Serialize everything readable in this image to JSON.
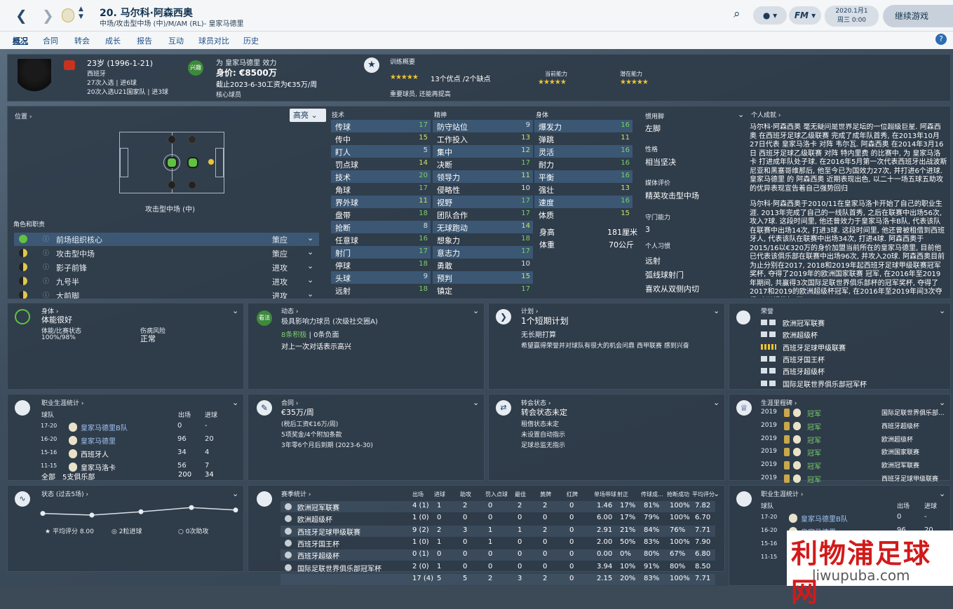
{
  "header": {
    "number_name": "20. 马尔科·阿森西奥",
    "position_club": "中场/攻击型中场 (中)/M/AM (RL)- 皇家马德里",
    "date": "2020.1月1",
    "weekday_time": "周三 0:00",
    "continue": "继续游戏",
    "fm": "FM"
  },
  "menu": [
    "概况",
    "合同",
    "转会",
    "成长",
    "报告",
    "互动",
    "球员对比",
    "历史"
  ],
  "profile": {
    "age": "23岁 (1996-1-21)",
    "nation": "西班牙",
    "caps": "27次入选 | 进6球",
    "u21": "20次入选U21国家队 | 进3球",
    "plays_for": "为 皇家马德里 效力",
    "value": "身价: €8500万",
    "contract": "截止2023-6-30工资为€35万/周",
    "squad_status": "核心球员",
    "badge": "兴趣"
  },
  "training": {
    "title": "训练概要",
    "summary": "13个优点 /2个缺点",
    "note": "重要球员, 还能再提高",
    "current_label": "当前能力",
    "potential_label": "潜在能力"
  },
  "position": {
    "title": "位置",
    "dropdown": "高亮",
    "pos_name": "攻击型中场 (中)"
  },
  "roles": {
    "title": "角色和职责",
    "items": [
      {
        "name": "前场组织核心",
        "duty": "策应"
      },
      {
        "name": "攻击型中场",
        "duty": "策应"
      },
      {
        "name": "影子前锋",
        "duty": "进攻"
      },
      {
        "name": "九号半",
        "duty": "进攻"
      },
      {
        "name": "大前脚",
        "duty": "进攻"
      }
    ]
  },
  "technical": {
    "title": "技术",
    "items": [
      [
        "传球",
        "17"
      ],
      [
        "传中",
        "15"
      ],
      [
        "盯人",
        "5"
      ],
      [
        "罚点球",
        "14"
      ],
      [
        "技术",
        "20"
      ],
      [
        "角球",
        "17"
      ],
      [
        "界外球",
        "11"
      ],
      [
        "盘带",
        "18"
      ],
      [
        "抢断",
        "8"
      ],
      [
        "任意球",
        "16"
      ],
      [
        "射门",
        "17"
      ],
      [
        "停球",
        "18"
      ],
      [
        "头球",
        "9"
      ],
      [
        "远射",
        "18"
      ]
    ]
  },
  "mental": {
    "title": "精神",
    "items": [
      [
        "防守站位",
        "9"
      ],
      [
        "工作投入",
        "13"
      ],
      [
        "集中",
        "12"
      ],
      [
        "决断",
        "17"
      ],
      [
        "领导力",
        "11"
      ],
      [
        "侵略性",
        "10"
      ],
      [
        "视野",
        "17"
      ],
      [
        "团队合作",
        "17"
      ],
      [
        "无球跑动",
        "14"
      ],
      [
        "想象力",
        "18"
      ],
      [
        "意志力",
        "17"
      ],
      [
        "勇敢",
        "10"
      ],
      [
        "预判",
        "15"
      ],
      [
        "镇定",
        "17"
      ]
    ]
  },
  "physical": {
    "title": "身体",
    "items": [
      [
        "爆发力",
        "16"
      ],
      [
        "弹跳",
        "11"
      ],
      [
        "灵活",
        "16"
      ],
      [
        "耐力",
        "16"
      ],
      [
        "平衡",
        "16"
      ],
      [
        "强壮",
        "13"
      ],
      [
        "速度",
        "16"
      ],
      [
        "体质",
        "15"
      ]
    ],
    "height_label": "身高",
    "height": "181厘米",
    "weight_label": "体重",
    "weight": "70公斤"
  },
  "info": {
    "foot_label": "惯用脚",
    "foot": "左脚",
    "personality_label": "性格",
    "personality": "相当坚决",
    "media_label": "媒体评价",
    "media": "精英攻击型中场",
    "gk_label": "守门能力",
    "gk": "3",
    "habits_label": "个人习惯",
    "habits": [
      "远射",
      "弧线球射门",
      "喜欢从双侧内切"
    ]
  },
  "achievements": {
    "title": "个人成就",
    "text1": "马尔科·阿森西奥 毫无疑问是世界足坛的一位超级巨星. 阿森西奥 在西班牙足球乙级联赛 完成了成年队首秀, 在2013年10月27日代表 皇家马洛卡 对阵 韦尔瓦. 阿森西奥 在2014年3月16日 西班牙足球乙级联赛 对阵 特内里费 的比赛中, 为 皇家马洛卡 打进成年队处子球. 在2016年5月第一次代表西班牙出战波斯尼亚和黑塞哥维那后, 他至今已为国效力27次, 并打进6个进球. 皇家马德里 的 阿森西奥 近期表现出色, 以二十一场五球五助攻的优异表现宣告着自己强势回归",
    "text2": "马尔科·阿森西奥于2010/11在皇家马洛卡开始了自己的职业生涯. 2013年完成了自己的一线队首秀, 之后在联赛中出场56次, 攻入7球. 这段时间里, 他还曾效力于皇家马洛卡B队, 代表该队在联赛中出场14次, 打进3球. 这段时间里, 他还曾被租借到西班牙人, 代表该队在联赛中出场34次, 打进4球. 阿森西奥于2015/16以€320万的身价加盟当前所在的皇家马德里, 目前他已代表该俱乐部在联赛中出场96次, 并攻入20球. 阿森西奥目前为止分别在2017, 2018和2019年起西班牙足球甲级联赛冠军奖杯, 夺得了2019年的欧洲国家联赛 冠军, 在2016年至2019年期间, 共赢得3次国际足联世界俱乐部杯的冠军奖杯, 夺得了2017和2019的欧洲超级杯冠军, 在2016年至2019年间3次夺得 欧洲超级杯 冠"
  },
  "body": {
    "title": "身体",
    "status": "体能很好",
    "cond_label": "体能/比赛状态",
    "cond": "100%/98%",
    "risk_label": "伤病风险",
    "risk": "正常"
  },
  "dynamics": {
    "title": "动态",
    "influence": "极具影响力球员 (次级社交圈A)",
    "pos": "8条积极",
    "neg": "0条负面",
    "note": "对上一次对话表示高兴",
    "badge": "看法"
  },
  "plan": {
    "title": "计划",
    "plan": "1个短期计划",
    "longterm": "无长期打算",
    "wish": "希望赢得荣誉并对球队有很大的机会问鼎 西甲联赛 感到兴奋"
  },
  "honours": {
    "title": "荣誉",
    "items": [
      "欧洲冠军联赛",
      "欧洲超级杯",
      "西班牙足球甲级联赛",
      "西班牙国王杯",
      "西班牙超级杯",
      "国际足联世界俱乐部冠军杯"
    ]
  },
  "career": {
    "title": "职业生涯统计",
    "col_team": "球队",
    "col_apps": "出场",
    "col_goals": "进球",
    "rows": [
      [
        "17-20",
        "皇家马德里B队",
        "0",
        "-"
      ],
      [
        "16-20",
        "皇家马德里",
        "96",
        "20"
      ],
      [
        "15-16",
        "西班牙人",
        "34",
        "4"
      ],
      [
        "11-15",
        "皇家马洛卡",
        "56",
        "7"
      ]
    ],
    "total_label": "全部",
    "total_clubs": "5支俱乐部",
    "total_apps": "200",
    "total_goals": "34"
  },
  "contract": {
    "title": "合同",
    "wage": "€35万/周",
    "net": "(税后工资€16万/周)",
    "bonus": "5项奖金/4个附加条款",
    "expiry": "3年零6个月后到期 (2023-6-30)"
  },
  "transfer": {
    "title": "转会状态",
    "status": "转会状态未定",
    "loan": "租借状态未定",
    "auto": "未设置自动指示",
    "club": "足球总监无指示"
  },
  "career_high": {
    "title": "生涯里程碑",
    "rows": [
      [
        "2019",
        "冠军",
        "国际足联世界俱乐部..."
      ],
      [
        "2019",
        "冠军",
        "西班牙超级杯"
      ],
      [
        "2019",
        "冠军",
        "欧洲超级杯"
      ],
      [
        "2019",
        "冠军",
        "欧洲国家联赛"
      ],
      [
        "2019",
        "冠军",
        "欧洲冠军联赛"
      ],
      [
        "2019",
        "冠军",
        "西班牙足球甲级联赛"
      ]
    ]
  },
  "form": {
    "title": "状态 (过去5场)",
    "avg_label": "平均评分",
    "avg": "8.00",
    "goals": "2粒进球",
    "assists": "0次助攻",
    "ratings": [
      7.2,
      7.0,
      7.4,
      7.9,
      7.6
    ]
  },
  "season": {
    "title": "赛季统计",
    "headers": [
      "出场",
      "进球",
      "助攻",
      "罚入点球",
      "最佳",
      "黄牌",
      "红牌",
      "单场带球",
      "射正",
      "传球成...",
      "抢断成功",
      "平均评分"
    ],
    "rows": [
      [
        "欧洲冠军联赛",
        "4 (1)",
        "1",
        "2",
        "0",
        "2",
        "2",
        "0",
        "1.46",
        "17%",
        "81%",
        "100%",
        "7.82"
      ],
      [
        "欧洲超级杯",
        "1 (0)",
        "0",
        "0",
        "0",
        "0",
        "0",
        "0",
        "6.00",
        "17%",
        "79%",
        "100%",
        "6.70"
      ],
      [
        "西班牙足球甲级联赛",
        "9 (2)",
        "2",
        "3",
        "1",
        "1",
        "2",
        "0",
        "2.91",
        "21%",
        "84%",
        "76%",
        "7.71"
      ],
      [
        "西班牙国王杯",
        "1 (0)",
        "1",
        "0",
        "1",
        "0",
        "0",
        "0",
        "2.00",
        "50%",
        "83%",
        "100%",
        "7.90"
      ],
      [
        "西班牙超级杯",
        "0 (1)",
        "0",
        "0",
        "0",
        "0",
        "0",
        "0",
        "0.00",
        "0%",
        "80%",
        "67%",
        "6.80"
      ],
      [
        "国际足联世界俱乐部冠军杯",
        "2 (0)",
        "1",
        "0",
        "0",
        "0",
        "0",
        "0",
        "3.94",
        "10%",
        "91%",
        "80%",
        "8.50"
      ],
      [
        "",
        "17 (4)",
        "5",
        "5",
        "2",
        "3",
        "2",
        "0",
        "2.15",
        "20%",
        "83%",
        "100%",
        "7.71"
      ]
    ]
  },
  "career2": {
    "title": "职业生涯统计",
    "col_team": "球队",
    "col_apps": "出场",
    "col_goals": "进球",
    "rows": [
      [
        "17-20",
        "皇家马德里B队",
        "0",
        "-"
      ],
      [
        "16-20",
        "皇家马德里",
        "96",
        "20"
      ],
      [
        "15-16",
        "",
        "",
        " "
      ],
      [
        "11-15",
        "",
        "",
        ""
      ]
    ]
  },
  "watermark": {
    "text": "利物浦足球网",
    "url": "liwupuba.com"
  }
}
